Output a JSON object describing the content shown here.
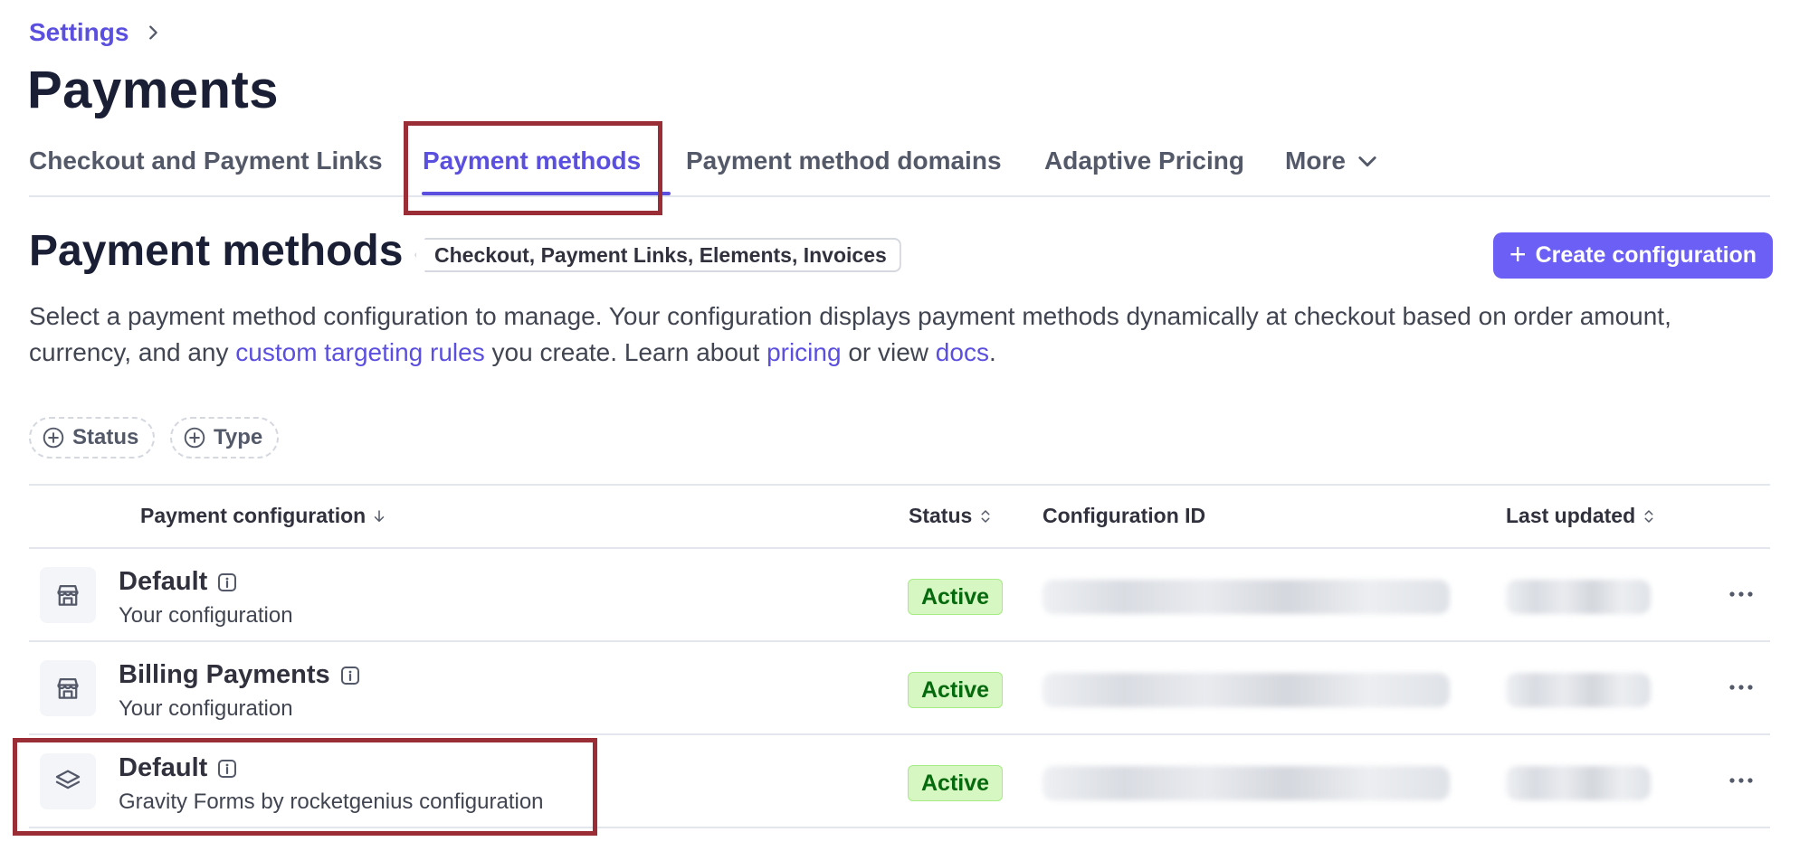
{
  "breadcrumb": {
    "parent": "Settings"
  },
  "page_title": "Payments",
  "tabs": [
    {
      "label": "Checkout and Payment Links"
    },
    {
      "label": "Payment methods",
      "active": true
    },
    {
      "label": "Payment method domains"
    },
    {
      "label": "Adaptive Pricing"
    },
    {
      "label": "More"
    }
  ],
  "section": {
    "title": "Payment methods",
    "scope_tag": "Checkout, Payment Links, Elements, Invoices",
    "create_button": "Create configuration",
    "description": {
      "part1": "Select a payment method configuration to manage. Your configuration displays payment methods dynamically at checkout based on order amount, currency, and any ",
      "link_targeting": "custom targeting rules",
      "part2": " you create. Learn about ",
      "link_pricing": "pricing",
      "part3": " or view ",
      "link_docs": "docs",
      "part4": "."
    }
  },
  "filters": [
    {
      "label": "Status",
      "icon": "plus-circle-icon"
    },
    {
      "label": "Type",
      "icon": "plus-circle-icon"
    }
  ],
  "table": {
    "headers": {
      "config": "Payment configuration",
      "status": "Status",
      "config_id": "Configuration ID",
      "last_updated": "Last updated"
    },
    "rows": [
      {
        "name": "Default",
        "subtitle": "Your configuration",
        "status": "Active",
        "icon": "storefront-icon"
      },
      {
        "name": "Billing Payments",
        "subtitle": "Your configuration",
        "status": "Active",
        "icon": "storefront-icon"
      },
      {
        "name": "Default",
        "subtitle": "Gravity Forms by rocketgenius configuration",
        "status": "Active",
        "icon": "layers-icon"
      }
    ]
  },
  "colors": {
    "accent": "#5b4fe0",
    "button": "#6c5ff5",
    "active_badge_bg": "#d7f7c2",
    "active_badge_text": "#05690d",
    "highlight_border": "#9b2d36"
  }
}
